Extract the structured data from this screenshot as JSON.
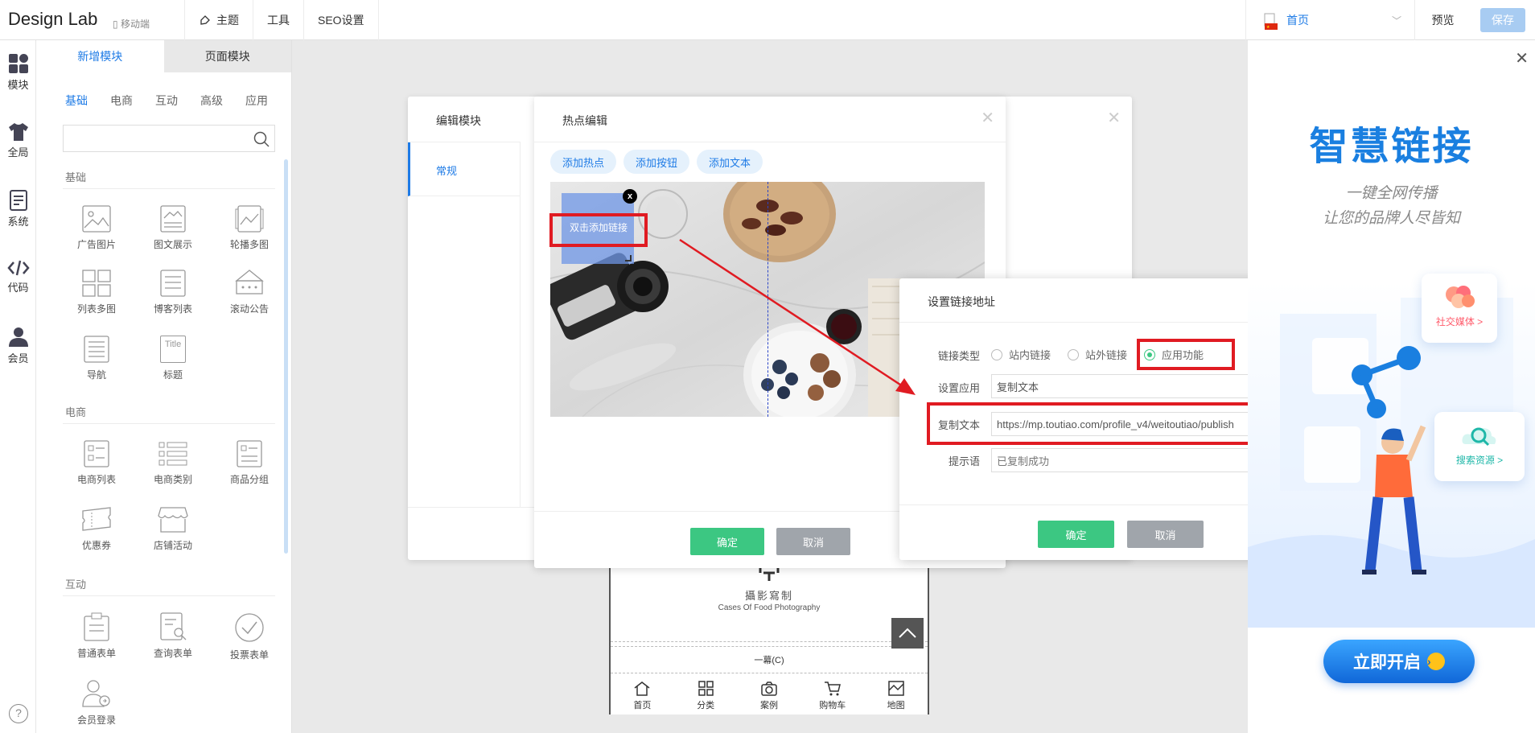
{
  "topbar": {
    "brand": "Design Lab",
    "mobile": "移动端",
    "menu": [
      "主题",
      "工具",
      "SEO设置"
    ],
    "home_label": "首页",
    "preview": "预览",
    "save": "保存"
  },
  "rail": [
    "模块",
    "全局",
    "系统",
    "代码",
    "会员"
  ],
  "help": "?",
  "module_panel": {
    "tabs": [
      "新增模块",
      "页面模块"
    ],
    "categories": [
      "基础",
      "电商",
      "互动",
      "高级",
      "应用"
    ],
    "sections": {
      "basic": "基础",
      "ecommerce": "电商",
      "interaction": "互动"
    },
    "basic_items": [
      "广告图片",
      "图文展示",
      "轮播多图",
      "列表多图",
      "博客列表",
      "滚动公告",
      "导航",
      "标题"
    ],
    "ecommerce_items": [
      "电商列表",
      "电商类别",
      "商品分组",
      "优惠券",
      "店铺活动"
    ],
    "interaction_items": [
      "普通表单",
      "查询表单",
      "投票表单",
      "会员登录"
    ],
    "title_icon_text": "Title"
  },
  "edit_dialog": {
    "title": "编辑模块",
    "side_active": "常规"
  },
  "hotspot_dialog": {
    "title": "热点编辑",
    "pills": [
      "添加热点",
      "添加按钮",
      "添加文本"
    ],
    "hotspot_label": "双击添加链接",
    "hotspot_close": "x",
    "ok": "确定",
    "cancel": "取消"
  },
  "link_dialog": {
    "title": "设置链接地址",
    "type_label": "链接类型",
    "type_options": [
      "站内链接",
      "站外链接",
      "应用功能"
    ],
    "app_label": "设置应用",
    "app_value": "复制文本",
    "copy_label": "复制文本",
    "copy_value": "https://mp.toutiao.com/profile_v4/weitoutiao/publish",
    "tip_label": "提示语",
    "tip_placeholder": "已复制成功",
    "ok": "确定",
    "cancel": "取消"
  },
  "phone": {
    "sign_cn": "攝影寫制",
    "sign_en": "Cases Of Food Photography",
    "footer": "一幕(C)",
    "nav": [
      "首页",
      "分类",
      "案例",
      "购物车",
      "地图"
    ]
  },
  "ad": {
    "title": "智慧链接",
    "sub1": "一键全网传播",
    "sub2": "让您的品牌人尽皆知",
    "card1": "社交媒体 >",
    "card2": "搜索资源 >",
    "cta": "立即开启",
    "cta_arrow": "›"
  },
  "colors": {
    "accent": "#1e7be6",
    "green": "#3cc782",
    "highlight": "#e01b22"
  }
}
